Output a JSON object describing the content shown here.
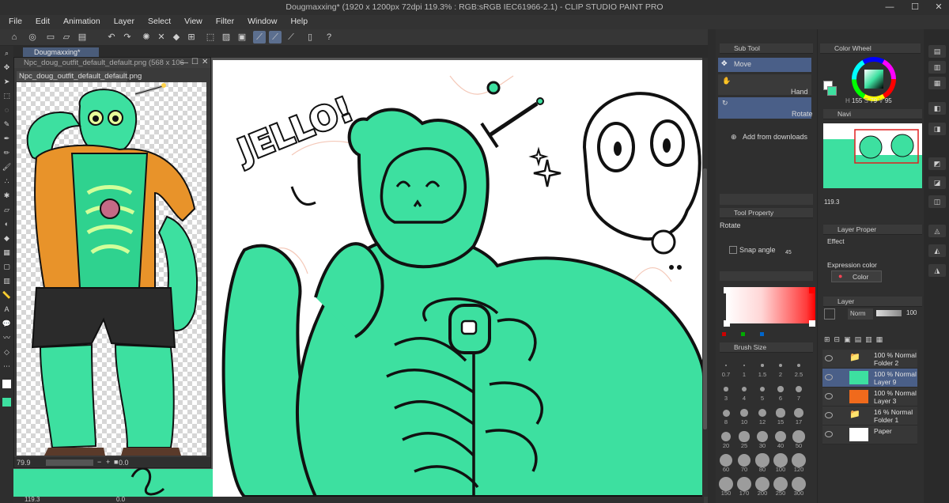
{
  "title_bar": {
    "title": "Dougmaxxing* (1920 x 1200px 72dpi 119.3% : RGB:sRGB IEC61966-2.1) - CLIP STUDIO PAINT PRO"
  },
  "menu": [
    "File",
    "Edit",
    "Animation",
    "Layer",
    "Select",
    "View",
    "Filter",
    "Window",
    "Help"
  ],
  "document_tab": {
    "label": "Dougmaxxing*"
  },
  "sub_view": {
    "window_title": "Npc_doug_outfit_default_default.png (568 x 106",
    "tab_label": "Npc_doug_outfit_default_default.png",
    "zoom": "79.9",
    "angle": "0.0"
  },
  "canvas": {
    "art_text": "JELLO!",
    "status_zoom": "119.3",
    "status_angle": "0.0"
  },
  "sub_tool": {
    "header": "Sub Tool",
    "items": [
      {
        "label": "Move",
        "icon": "move-icon"
      },
      {
        "label": "Hand",
        "icon": "hand-icon"
      },
      {
        "label": "Rotate",
        "icon": "rotate-icon"
      }
    ],
    "add_label": "Add from downloads"
  },
  "tool_property": {
    "header": "Tool Property",
    "tool_name": "Rotate",
    "snap_angle_label": "Snap angle",
    "snap_angle_value": "45"
  },
  "brush_size": {
    "header": "Brush Size",
    "sizes": [
      "0.7",
      "1",
      "1.5",
      "2",
      "2.5",
      "3",
      "4",
      "5",
      "6",
      "7",
      "8",
      "10",
      "12",
      "15",
      "17",
      "20",
      "25",
      "30",
      "40",
      "50",
      "60",
      "70",
      "80",
      "100",
      "120",
      "150",
      "170",
      "200",
      "250",
      "300"
    ]
  },
  "color_wheel": {
    "header": "Color Wheel",
    "h": "155",
    "s": "79",
    "v": "95",
    "main_color": "#3de0a0"
  },
  "navigator": {
    "header": "Navi",
    "zoom": "119.3"
  },
  "layer_property": {
    "header": "Layer Proper",
    "effect_label": "Effect",
    "expression_color_label": "Expression color",
    "color_mode": "Color"
  },
  "layer_panel": {
    "header": "Layer",
    "blend_mode": "Norm",
    "opacity": "100",
    "layers": [
      {
        "line1": "100 % Normal",
        "line2": "Folder 2",
        "type": "folder",
        "selected": false
      },
      {
        "line1": "100 % Normal",
        "line2": "Layer 9",
        "type": "raster",
        "selected": true,
        "swatch": "#3de0a0"
      },
      {
        "line1": "100 % Normal",
        "line2": "Layer 3",
        "type": "raster",
        "selected": false,
        "swatch": "#f06a1c"
      },
      {
        "line1": "16 % Normal",
        "line2": "Folder 1",
        "type": "folder",
        "selected": false
      },
      {
        "line1": "Paper",
        "line2": "",
        "type": "paper",
        "selected": false,
        "swatch": "#ffffff"
      }
    ]
  },
  "colors": {
    "accent": "#4a5f88",
    "art_green": "#3de0a0",
    "orange": "#f06a1c"
  }
}
